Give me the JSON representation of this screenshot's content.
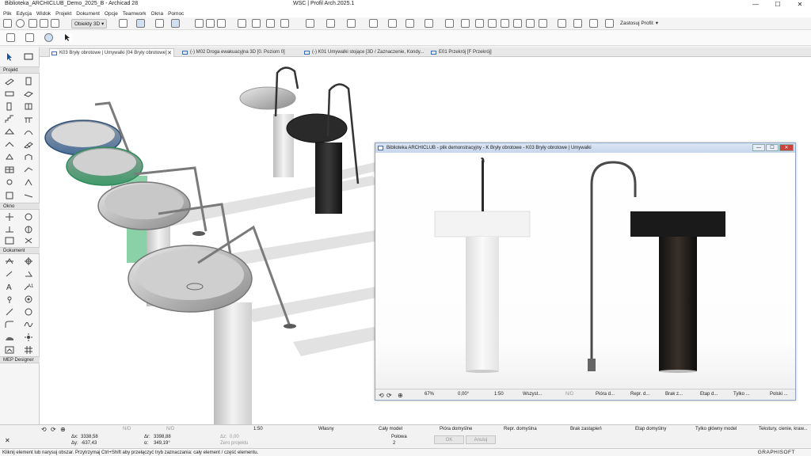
{
  "window": {
    "app_title": "Biblioteka_ARCHICLUB_Demo_2025_B - Archicad 28",
    "doc_title": "WSC | Profil Arch.2025.1",
    "min": "—",
    "max": "☐",
    "close": "✕"
  },
  "menu": [
    "Plik",
    "Edycja",
    "Widok",
    "Projekt",
    "Dokument",
    "Opcje",
    "Teamwork",
    "Okna",
    "Pomoc"
  ],
  "toolbar": {
    "view_select": "Obiekty 3D ▾",
    "profile": "Zastosuj Profil: ▾"
  },
  "tabs": [
    {
      "label": "K03 Bryły obrotowe | Umywalki [04 Bryły obrotowe]",
      "active": true
    },
    {
      "label": "(-) M02 Droga ewakuacyjna 3D [0. Poziom 0]",
      "active": false
    },
    {
      "label": "(-) K01 Umywalki stojące [3D / Zaznaczenie, Kondy...",
      "active": false
    },
    {
      "label": "E01 Przekrój [F Przekrój]",
      "active": false
    }
  ],
  "toolbox": {
    "sections": [
      "Projekt",
      "Okno",
      "Dokument",
      "MEP Designer"
    ]
  },
  "floating_window": {
    "title": "Biblioteka ARCHICLUB - plik demonstracyjny - K Bryły obrotowe - K03 Bryły obrotowe | Umywalki",
    "status": [
      "67%",
      "0,00°",
      "1:50",
      "Wszyst...",
      "N/D",
      "Pióra d...",
      "Repr. d...",
      "Brak z...",
      "Etap d...",
      "Tylko ...",
      "Polski ..."
    ]
  },
  "infobox": {
    "nd1": "N/D",
    "nd2": "N/D",
    "scale": "1:50",
    "own": "Własny",
    "model": "Cały model",
    "pens": "Pióra domyślne",
    "repr": "Repr. domyślna",
    "override": "Brak zastąpień",
    "phase": "Etap domyślny",
    "main_model": "Tylko główny model",
    "textures": "Tekstury, cienie, kraw...",
    "dx_label": "Δx:",
    "dx": "3338,58",
    "dy_label": "Δy:",
    "dy": "-637,43",
    "ax_label": "Δr:",
    "ax": "3398,88",
    "angle_label": "α:",
    "angle": "349,19°",
    "az_label": "Δz:",
    "az": "0,00",
    "zero": "Zero projektu",
    "half": "Połowa",
    "half_num": "2",
    "ok": "OK",
    "cancel": "Anuluj"
  },
  "statusbar": {
    "hint": "Kliknij element lub narysuj obszar. Przytrzymaj Ctrl+Shift aby przełączyć tryb zaznaczania: cały element / część elementu.",
    "brand": "GRAPHISOFT"
  }
}
